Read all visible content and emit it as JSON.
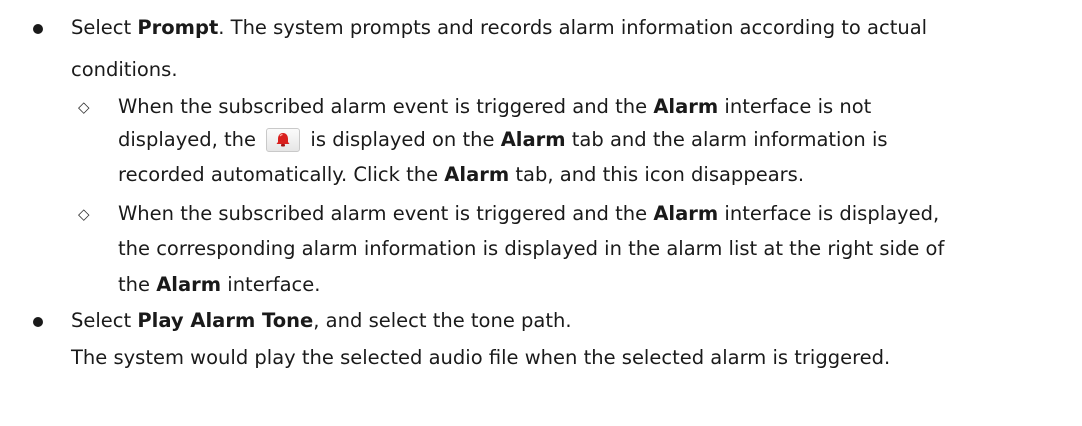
{
  "bullet1": {
    "pre": "Select ",
    "bold": "Prompt",
    "post": ". The system prompts and records alarm information according to actual",
    "line2": "conditions."
  },
  "sub1": {
    "l1_pre": "When the subscribed alarm event is triggered and the ",
    "l1_bold": "Alarm",
    "l1_post": " interface is not",
    "l2_pre": "displayed, the ",
    "l2_icon": "alarm-bell-icon",
    "l2_mid": " is displayed on the ",
    "l2_bold": "Alarm",
    "l2_post": " tab and the alarm information is",
    "l3_pre": "recorded automatically. Click the ",
    "l3_bold": "Alarm",
    "l3_post": " tab, and this icon disappears."
  },
  "sub2": {
    "l1_pre": "When the subscribed alarm event is triggered and the ",
    "l1_bold": "Alarm",
    "l1_post": " interface is displayed,",
    "l2": "the corresponding alarm information is displayed in the alarm list at the right side of",
    "l3_pre": "the ",
    "l3_bold": "Alarm",
    "l3_post": " interface."
  },
  "bullet2": {
    "pre": "Select ",
    "bold": "Play Alarm Tone",
    "post": ", and select the tone path.",
    "line2": "The system would play the selected audio file when the selected alarm is triggered."
  },
  "colors": {
    "icon_red": "#d9201e"
  }
}
